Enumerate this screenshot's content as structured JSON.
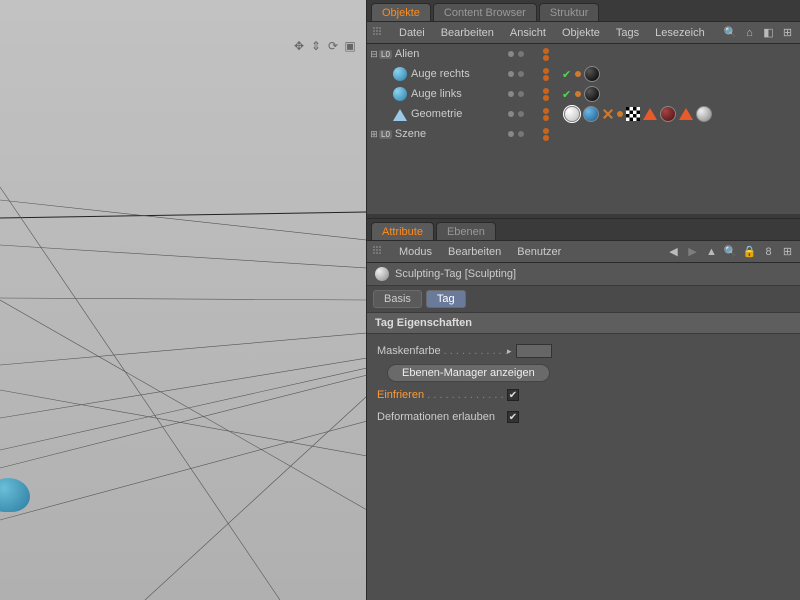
{
  "tabs_top": {
    "objekte": "Objekte",
    "content_browser": "Content Browser",
    "struktur": "Struktur"
  },
  "menu_obj": {
    "datei": "Datei",
    "bearbeiten": "Bearbeiten",
    "ansicht": "Ansicht",
    "objekte": "Objekte",
    "tags": "Tags",
    "lesezeich": "Lesezeich"
  },
  "tree": {
    "alien": "Alien",
    "auge_rechts": "Auge rechts",
    "auge_links": "Auge links",
    "geometrie": "Geometrie",
    "szene": "Szene",
    "layer_badge": "L0"
  },
  "tabs_attr": {
    "attribute": "Attribute",
    "ebenen": "Ebenen"
  },
  "menu_attr": {
    "modus": "Modus",
    "bearbeiten": "Bearbeiten",
    "benutzer": "Benutzer"
  },
  "attr": {
    "title": "Sculpting-Tag [Sculpting]",
    "subtabs": {
      "basis": "Basis",
      "tag": "Tag"
    },
    "section": "Tag Eigenschaften",
    "maskenfarbe": "Maskenfarbe",
    "ebenen_btn": "Ebenen-Manager anzeigen",
    "einfrieren": "Einfrieren",
    "deformationen": "Deformationen erlauben"
  }
}
